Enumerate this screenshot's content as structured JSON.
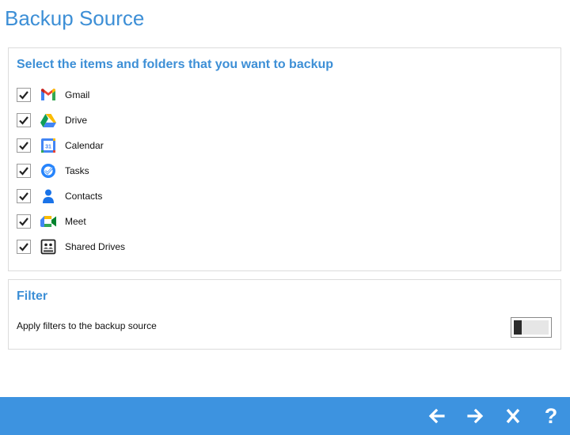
{
  "page": {
    "title": "Backup Source"
  },
  "items_panel": {
    "heading": "Select the items and folders that you want to backup",
    "items": [
      {
        "label": "Gmail",
        "icon": "gmail-icon",
        "checked": true
      },
      {
        "label": "Drive",
        "icon": "drive-icon",
        "checked": true
      },
      {
        "label": "Calendar",
        "icon": "calendar-icon",
        "checked": true,
        "icon_text": "31"
      },
      {
        "label": "Tasks",
        "icon": "tasks-icon",
        "checked": true
      },
      {
        "label": "Contacts",
        "icon": "contacts-icon",
        "checked": true
      },
      {
        "label": "Meet",
        "icon": "meet-icon",
        "checked": true
      },
      {
        "label": "Shared Drives",
        "icon": "shared-drives-icon",
        "checked": true
      }
    ]
  },
  "filter_panel": {
    "heading": "Filter",
    "description": "Apply filters to the backup source",
    "enabled": false
  },
  "footer": {
    "help_label": "?",
    "buttons": [
      "back-arrow-icon",
      "forward-arrow-icon",
      "close-icon",
      "help-icon"
    ]
  },
  "colors": {
    "accent": "#3d8fd6",
    "footer_bar": "#3d93e0",
    "panel_border": "#dcdcdc"
  }
}
